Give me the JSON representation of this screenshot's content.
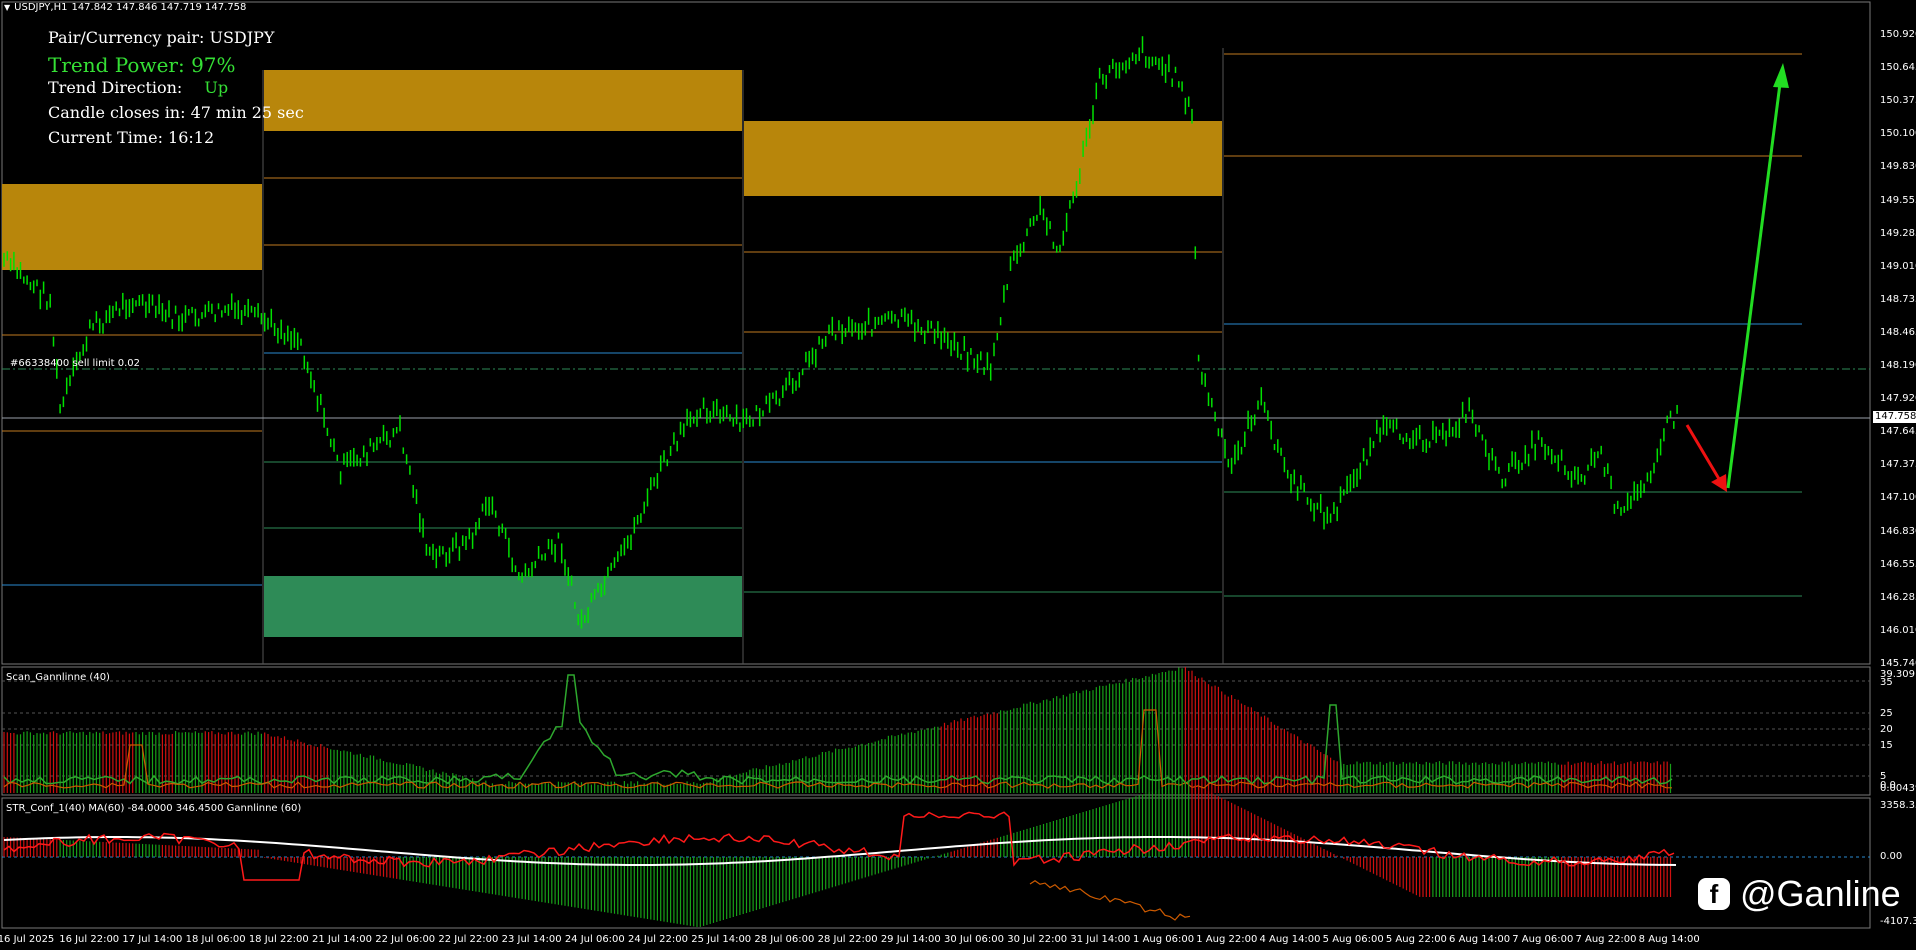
{
  "header": {
    "symbol": "USDJPY,H1",
    "ohlc": "147.842 147.846 147.719 147.758"
  },
  "info_panel": {
    "pair": "Pair/Currency pair: USDJPY",
    "trend_power": "Trend Power: 97%",
    "trend_direction_label": "Trend Direction:",
    "trend_direction_value": "Up",
    "candle_closes": "Candle closes in: 47 min 25 sec",
    "current_time": "Current Time: 16:12"
  },
  "order_label": "#66338400 sell limit 0.02",
  "price_axis": [
    "150.920",
    "150.645",
    "150.375",
    "150.100",
    "149.830",
    "149.555",
    "149.285",
    "149.010",
    "148.735",
    "148.465",
    "148.190",
    "147.920",
    "147.645",
    "147.375",
    "147.100",
    "146.830",
    "146.555",
    "146.285",
    "146.010",
    "145.740"
  ],
  "current_price": "147.758",
  "sub1": {
    "title": "Scan_Gannlinne (40)",
    "axis": [
      "39.3091",
      "35",
      "25",
      "20",
      "15",
      "5",
      "0.0",
      "0.00439"
    ]
  },
  "sub2": {
    "title": "STR_Conf_1(40) MA(60) -84.0000 346.4500  Gannlinne (60)",
    "axis": [
      "3358.35",
      "0.00",
      "-4107.35"
    ]
  },
  "time_axis": [
    "16 Jul 2025",
    "16 Jul 22:00",
    "17 Jul 14:00",
    "18 Jul 06:00",
    "18 Jul 22:00",
    "21 Jul 14:00",
    "22 Jul 06:00",
    "22 Jul 22:00",
    "23 Jul 14:00",
    "24 Jul 06:00",
    "24 Jul 22:00",
    "25 Jul 14:00",
    "28 Jul 06:00",
    "28 Jul 22:00",
    "29 Jul 14:00",
    "30 Jul 06:00",
    "30 Jul 22:00",
    "31 Jul 14:00",
    "1 Aug 06:00",
    "1 Aug 22:00",
    "4 Aug 14:00",
    "5 Aug 06:00",
    "5 Aug 22:00",
    "6 Aug 14:00",
    "7 Aug 06:00",
    "7 Aug 22:00",
    "8 Aug 14:00"
  ],
  "brand": {
    "icon": "facebook-icon",
    "handle": "@Ganline"
  },
  "colors": {
    "candle": "#00e000",
    "supply_zone": "#b8860b",
    "demand_zone": "#2e8b57",
    "arrow_up": "#22dd22",
    "arrow_down": "#ee1111",
    "grid": "#2a2a2a"
  }
}
